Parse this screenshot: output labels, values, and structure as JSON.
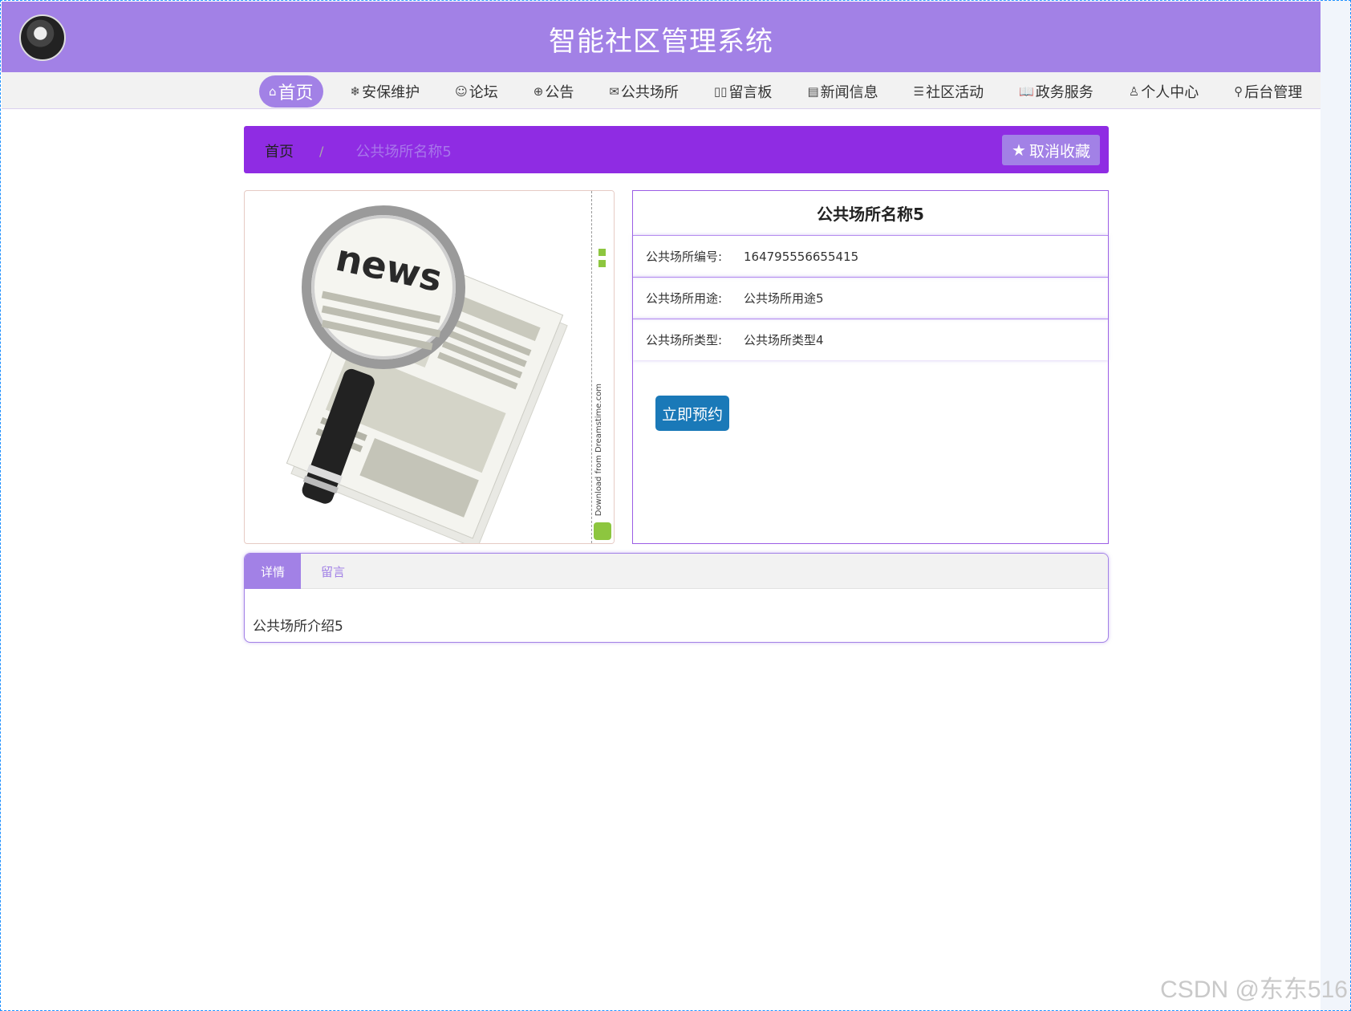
{
  "header": {
    "title": "智能社区管理系统"
  },
  "nav": {
    "items": [
      {
        "icon": "⌂",
        "label": "首页",
        "active": true
      },
      {
        "icon": "❄",
        "label": "安保维护"
      },
      {
        "icon": "☺",
        "label": "论坛"
      },
      {
        "icon": "⊕",
        "label": "公告"
      },
      {
        "icon": "✉",
        "label": "公共场所"
      },
      {
        "icon": "▯▯",
        "label": "留言板"
      },
      {
        "icon": "▤",
        "label": "新闻信息"
      },
      {
        "icon": "☰",
        "label": "社区活动"
      },
      {
        "icon": "📖",
        "label": "政务服务"
      },
      {
        "icon": "♙",
        "label": "个人中心"
      },
      {
        "icon": "⚲",
        "label": "后台管理"
      }
    ]
  },
  "breadcrumb": {
    "home": "首页",
    "separator": "/",
    "current": "公共场所名称5"
  },
  "favorite_button": {
    "icon": "★",
    "label": "取消收藏"
  },
  "image_panel": {
    "strip_text": "Download from Dreamstime.com"
  },
  "detail": {
    "title": "公共场所名称5",
    "rows": [
      {
        "label": "公共场所编号:",
        "value": "164795556655415"
      },
      {
        "label": "公共场所用途:",
        "value": "公共场所用途5"
      },
      {
        "label": "公共场所类型:",
        "value": "公共场所类型4"
      }
    ],
    "book_button": "立即预约"
  },
  "tabs": {
    "items": [
      {
        "label": "详情",
        "active": true
      },
      {
        "label": "留言",
        "active": false
      }
    ],
    "content": "公共场所介绍5"
  },
  "watermark": "CSDN @东东516",
  "colors": {
    "header": "#a281e6",
    "breadcrumb_bar": "#8f2ce3",
    "primary_button": "#1a79b8"
  }
}
